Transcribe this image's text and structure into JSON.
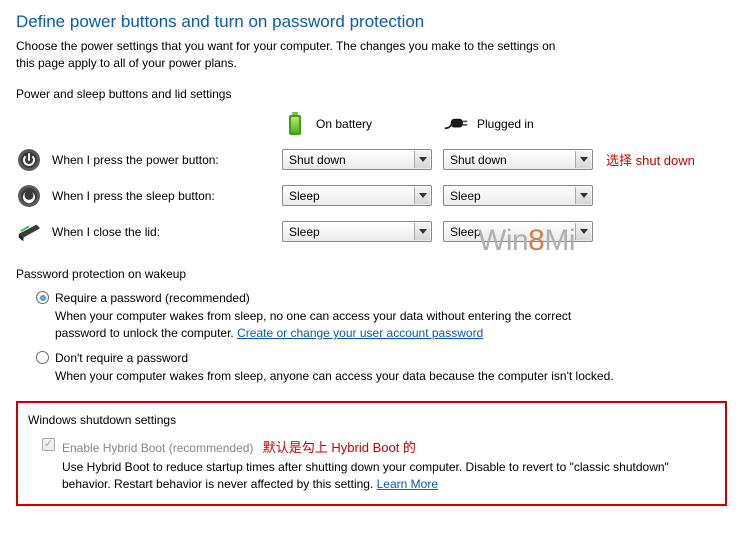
{
  "page": {
    "title": "Define power buttons and turn on password protection",
    "description": "Choose the power settings that you want for your computer. The changes you make to the settings on this page apply to all of your power plans."
  },
  "buttons_section": {
    "heading": "Power and sleep buttons and lid settings",
    "col_battery": "On battery",
    "col_plugged": "Plugged in",
    "rows": {
      "power": {
        "label": "When I press the power button:",
        "battery_value": "Shut down",
        "plugged_value": "Shut down",
        "annotation": "选择 shut down"
      },
      "sleep": {
        "label": "When I press the sleep button:",
        "battery_value": "Sleep",
        "plugged_value": "Sleep"
      },
      "lid": {
        "label": "When I close the lid:",
        "battery_value": "Sleep",
        "plugged_value": "Sleep"
      }
    }
  },
  "watermark": {
    "prefix": "Win",
    "eight": "8",
    "suffix": "Mi"
  },
  "password_section": {
    "heading": "Password protection on wakeup",
    "require": {
      "label": "Require a password (recommended)",
      "desc_a": "When your computer wakes from sleep, no one can access your data without entering the correct password to unlock the computer. ",
      "link": "Create or change your user account password"
    },
    "dont": {
      "label": "Don't require a password",
      "desc": "When your computer wakes from sleep, anyone can access your data because the computer isn't locked."
    }
  },
  "shutdown_section": {
    "heading": "Windows shutdown settings",
    "hybrid": {
      "label": "Enable Hybrid Boot (recommended)",
      "annotation": "默认是勾上 Hybrid Boot 的",
      "desc_a": "Use Hybrid Boot to reduce startup times after shutting down your computer. Disable to revert to \"classic shutdown\" behavior. Restart behavior is never affected by this setting. ",
      "link": "Learn More"
    }
  }
}
